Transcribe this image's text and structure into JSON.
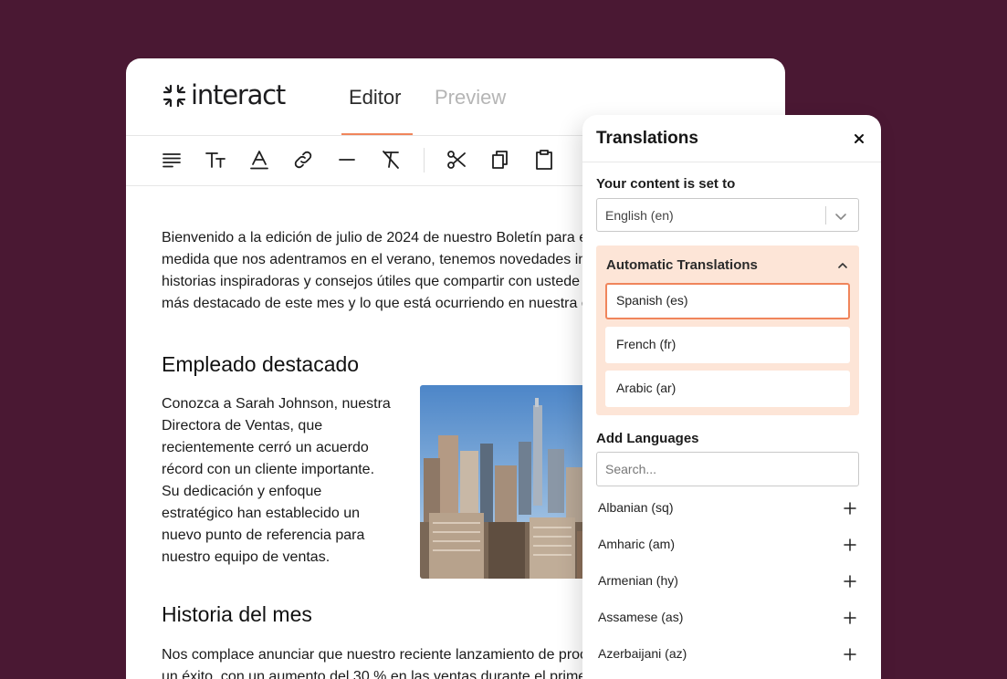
{
  "editor": {
    "logo_text": "interact",
    "tabs": [
      {
        "label": "Editor",
        "active": true
      },
      {
        "label": "Preview",
        "active": false
      }
    ],
    "toolbar": [
      {
        "icon": "align-left-icon"
      },
      {
        "icon": "text-size-icon"
      },
      {
        "icon": "text-color-icon"
      },
      {
        "icon": "link-icon"
      },
      {
        "icon": "horizontal-rule-icon"
      },
      {
        "icon": "clear-format-icon"
      },
      {
        "icon": "cut-icon"
      },
      {
        "icon": "copy-icon"
      },
      {
        "icon": "paste-icon"
      }
    ],
    "intro_lines": [
      "Bienvenido a la edición de julio de 2024 de nuestro Boletín para e",
      "medida que nos adentramos en el verano, tenemos novedades in",
      "historias inspiradoras y consejos útiles que compartir con ustede",
      "más destacado de este mes y lo que está ocurriendo en nuestra c"
    ],
    "section1_heading": "Empleado destacado",
    "section1_lines": [
      "Conozca a Sarah Johnson, nuestra",
      "Directora de Ventas, que",
      "recientemente cerró un acuerdo",
      "récord con un cliente importante.",
      "Su dedicación y enfoque",
      "estratégico han establecido un",
      "nuevo punto de referencia para",
      "nuestro equipo de ventas."
    ],
    "section2_heading": "Historia del mes",
    "section2_lines": [
      "Nos complace anunciar que nuestro reciente lanzamiento de proc",
      "un éxito, con un aumento del 30 % en las ventas durante el primer"
    ]
  },
  "panel": {
    "title": "Translations",
    "content_set_label": "Your content is set to",
    "content_language": "English (en)",
    "auto_title": "Automatic Translations",
    "auto_languages": [
      "Spanish (es)",
      "French (fr)",
      "Arabic (ar)"
    ],
    "add_label": "Add Languages",
    "search_placeholder": "Search...",
    "languages": [
      "Albanian (sq)",
      "Amharic (am)",
      "Armenian (hy)",
      "Assamese (as)",
      "Azerbaijani (az)"
    ],
    "accent_color": "#f0855b",
    "highlight_color": "#fde5d7"
  }
}
